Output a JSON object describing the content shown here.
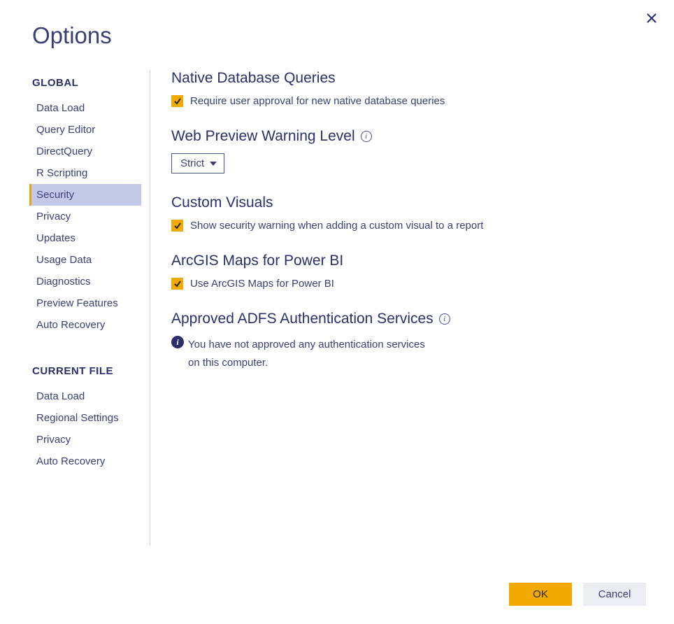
{
  "window": {
    "title": "Options"
  },
  "sidebar": {
    "groups": [
      {
        "title": "GLOBAL",
        "items": [
          {
            "label": "Data Load",
            "selected": false
          },
          {
            "label": "Query Editor",
            "selected": false
          },
          {
            "label": "DirectQuery",
            "selected": false
          },
          {
            "label": "R Scripting",
            "selected": false
          },
          {
            "label": "Security",
            "selected": true
          },
          {
            "label": "Privacy",
            "selected": false
          },
          {
            "label": "Updates",
            "selected": false
          },
          {
            "label": "Usage Data",
            "selected": false
          },
          {
            "label": "Diagnostics",
            "selected": false
          },
          {
            "label": "Preview Features",
            "selected": false
          },
          {
            "label": "Auto Recovery",
            "selected": false
          }
        ]
      },
      {
        "title": "CURRENT FILE",
        "items": [
          {
            "label": "Data Load",
            "selected": false
          },
          {
            "label": "Regional Settings",
            "selected": false
          },
          {
            "label": "Privacy",
            "selected": false
          },
          {
            "label": "Auto Recovery",
            "selected": false
          }
        ]
      }
    ]
  },
  "main": {
    "sections": {
      "native_db": {
        "heading": "Native Database Queries",
        "checkbox_label": "Require user approval for new native database queries",
        "checked": true
      },
      "web_preview": {
        "heading": "Web Preview Warning Level",
        "selected_value": "Strict"
      },
      "custom_visuals": {
        "heading": "Custom Visuals",
        "checkbox_label": "Show security warning when adding a custom visual to a report",
        "checked": true
      },
      "arcgis": {
        "heading": "ArcGIS Maps for Power BI",
        "checkbox_label": "Use ArcGIS Maps for Power BI",
        "checked": true
      },
      "adfs": {
        "heading": "Approved ADFS Authentication Services",
        "info_line1": "You have not approved any authentication services",
        "info_line2": "on this computer."
      }
    }
  },
  "footer": {
    "ok_label": "OK",
    "cancel_label": "Cancel"
  }
}
